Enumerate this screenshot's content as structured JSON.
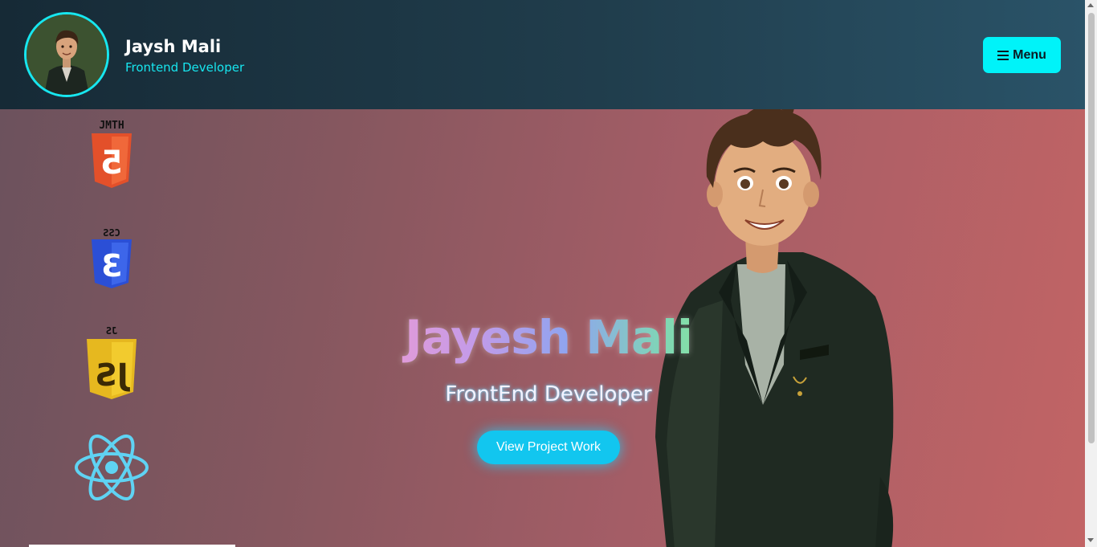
{
  "header": {
    "name": "Jaysh Mali",
    "role": "Frontend Developer",
    "menu_label": "Menu",
    "menu_icon": "hamburger-icon"
  },
  "tech_icons": [
    {
      "name": "html5-icon",
      "label": "JMTH",
      "glyph": "5"
    },
    {
      "name": "css3-icon",
      "label": "CSS",
      "glyph": "3"
    },
    {
      "name": "javascript-icon",
      "label": "JS",
      "glyph": "JS"
    },
    {
      "name": "react-icon"
    }
  ],
  "hero": {
    "title": "Jayesh Mali",
    "subtitle": "FrontEnd Developer",
    "button_label": "View Project Work"
  },
  "colors": {
    "accent": "#17e6ef",
    "menu_bg": "#00f3f9",
    "button_bg": "#12c6ef",
    "header_bg": "#1d3442"
  }
}
